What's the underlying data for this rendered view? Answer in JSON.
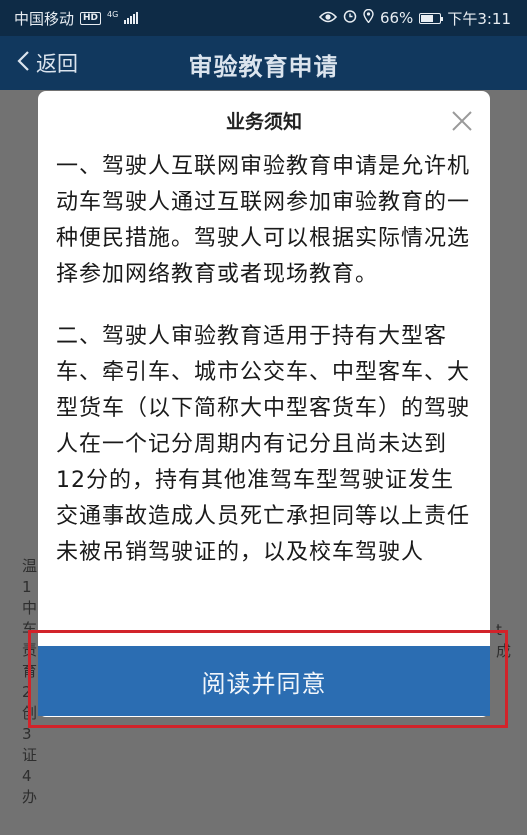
{
  "status_bar": {
    "carrier": "中国移动",
    "hd": "HD",
    "network": "4G",
    "battery": "66%",
    "battery_level": 0.66,
    "time": "下午3:11"
  },
  "nav": {
    "back_label": "返回",
    "title": "审验教育申请"
  },
  "background_text": {
    "left_lines": "温 1 中 车 责 育 2 创 3 证 4 办",
    "right_lines": "t 成"
  },
  "modal": {
    "title": "业务须知",
    "paragraphs": [
      "一、驾驶人互联网审验教育申请是允许机动车驾驶人通过互联网参加审验教育的一种便民措施。驾驶人可以根据实际情况选择参加网络教育或者现场教育。",
      "二、驾驶人审验教育适用于持有大型客车、牵引车、城市公交车、中型客车、大型货车（以下简称大中型客货车）的驾驶人在一个记分周期内有记分且尚未达到12分的，持有其他准驾车型驾驶证发生交通事故造成人员死亡承担同等以上责任未被吊销驾驶证的，以及校车驾驶人"
    ],
    "agree_label": "阅读并同意"
  },
  "colors": {
    "status_bar": "#0e2b46",
    "nav_bar": "#11385e",
    "agree_button": "#2b6db2",
    "highlight": "#d2232a",
    "overlay": "#727272"
  }
}
